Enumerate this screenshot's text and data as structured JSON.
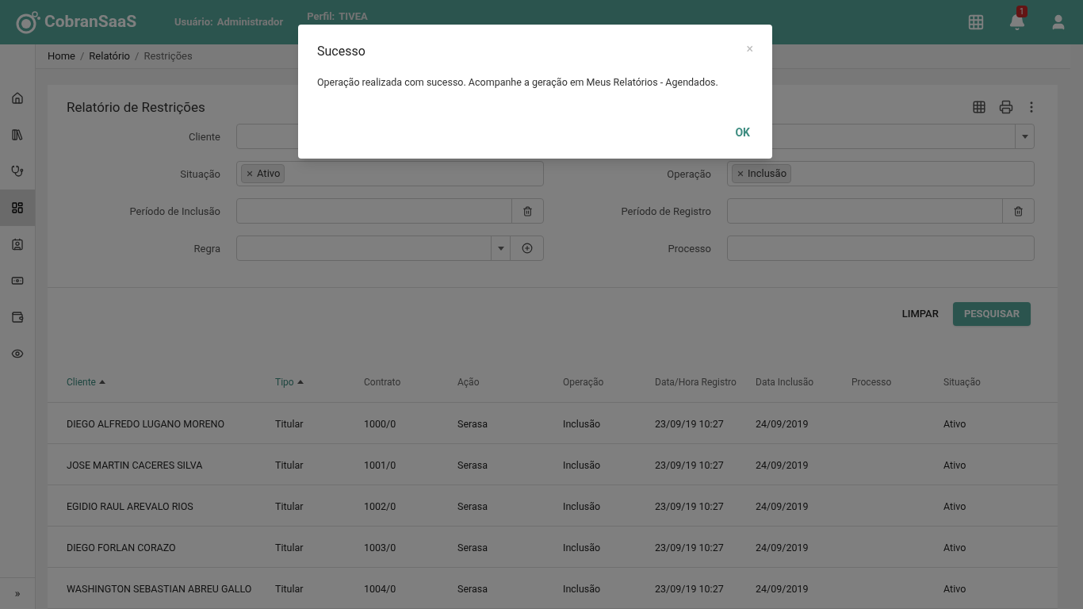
{
  "header": {
    "logo": "CobranSaaS",
    "user_label": "Usuário:",
    "user": "Administrador",
    "profile_label": "Perfil:",
    "profile": "TIVEA",
    "notifications": "1"
  },
  "sidebar": {
    "items": [
      {
        "selected": false
      },
      {
        "selected": false
      },
      {
        "selected": false
      },
      {
        "selected": true
      },
      {
        "selected": false
      },
      {
        "selected": false
      },
      {
        "selected": false
      },
      {
        "selected": false
      }
    ],
    "expand": "»"
  },
  "breadcrumb": {
    "separator": "/",
    "items": [
      "Home",
      "Relatório",
      "Restrições"
    ]
  },
  "card": {
    "title": "Relatório de Restrições"
  },
  "form": {
    "left": [
      {
        "label": "Cliente",
        "kind": "select"
      },
      {
        "label": "Situação",
        "kind": "tags",
        "tags": [
          "Ativo"
        ]
      },
      {
        "label": "Período de Inclusão",
        "kind": "date"
      },
      {
        "label": "Regra",
        "kind": "select-add"
      }
    ],
    "right": [
      {
        "kind": "select"
      },
      {
        "label": "Operação",
        "kind": "tags",
        "tags": [
          "Inclusão"
        ]
      },
      {
        "label": "Período de Registro",
        "kind": "date"
      },
      {
        "label": "Processo",
        "kind": "text"
      }
    ]
  },
  "buttons": {
    "clear": "LIMPAR",
    "search": "PESQUISAR"
  },
  "table": {
    "columns": [
      {
        "label": "Cliente",
        "sorted": true
      },
      {
        "label": "Tipo",
        "sorted": true
      },
      {
        "label": "Contrato",
        "sorted": false
      },
      {
        "label": "Ação",
        "sorted": false
      },
      {
        "label": "Operação",
        "sorted": false
      },
      {
        "label": "Data/Hora Registro",
        "sorted": false
      },
      {
        "label": "Data Inclusão",
        "sorted": false
      },
      {
        "label": "Processo",
        "sorted": false
      },
      {
        "label": "Situação",
        "sorted": false
      }
    ],
    "rows": [
      [
        "DIEGO ALFREDO LUGANO MORENO",
        "Titular",
        "1000/0",
        "Serasa",
        "Inclusão",
        "23/09/19 10:27",
        "24/09/2019",
        "",
        "Ativo"
      ],
      [
        "JOSE MARTIN CACERES SILVA",
        "Titular",
        "1001/0",
        "Serasa",
        "Inclusão",
        "23/09/19 10:27",
        "24/09/2019",
        "",
        "Ativo"
      ],
      [
        "EGIDIO RAUL AREVALO RIOS",
        "Titular",
        "1002/0",
        "Serasa",
        "Inclusão",
        "23/09/19 10:27",
        "24/09/2019",
        "",
        "Ativo"
      ],
      [
        "DIEGO FORLAN CORAZO",
        "Titular",
        "1003/0",
        "Serasa",
        "Inclusão",
        "23/09/19 10:27",
        "24/09/2019",
        "",
        "Ativo"
      ],
      [
        "WASHINGTON SEBASTIAN ABREU GALLO",
        "Titular",
        "1004/0",
        "Serasa",
        "Inclusão",
        "23/09/19 10:27",
        "24/09/2019",
        "",
        "Ativo"
      ]
    ]
  },
  "dialog": {
    "title": "Sucesso",
    "close": "×",
    "message": "Operação realizada com sucesso. Acompanhe a geração em Meus Relatórios - Agendados.",
    "ok": "OK"
  }
}
